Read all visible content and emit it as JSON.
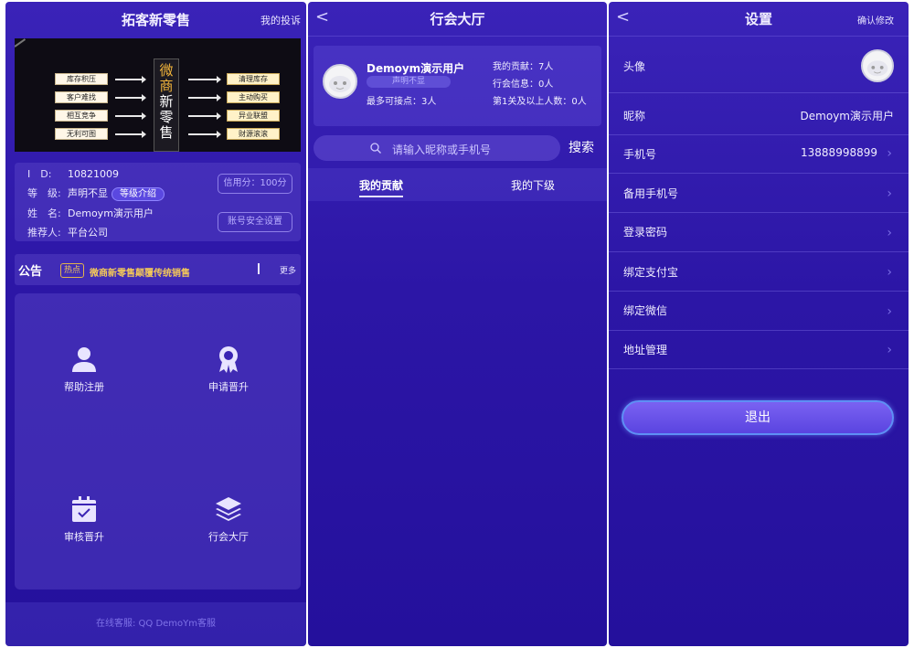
{
  "home": {
    "title": "拓客新零售",
    "complaint": "我的投诉",
    "banner": {
      "left_items": [
        "库存积压",
        "客户难找",
        "相互竞争",
        "无利可图"
      ],
      "center_chars": [
        "微",
        "商",
        "新",
        "零",
        "售"
      ],
      "right_items": [
        "清理库存",
        "主动购买",
        "异业联盟",
        "财源滚滚"
      ]
    },
    "profile": {
      "id_label": "I　D:",
      "id_value": "10821009",
      "level_label": "等　级:",
      "level_value": "声明不显",
      "level_intro": "等级介绍",
      "name_label": "姓　名:",
      "name_value": "Demoym演示用户",
      "referrer_label": "推荐人:",
      "referrer_value": "平台公司",
      "credit_button": "信用分：100分",
      "security_button": "账号安全设置"
    },
    "notice": {
      "title": "公告",
      "hot": "热点",
      "text": "微商新零售颠覆传统销售",
      "more": "更多"
    },
    "grid": [
      {
        "label": "帮助注册",
        "icon": "user-icon"
      },
      {
        "label": "申请晋升",
        "icon": "award-icon"
      },
      {
        "label": "审核晋升",
        "icon": "calendar-check-icon"
      },
      {
        "label": "行会大厅",
        "icon": "layers-icon"
      }
    ],
    "footer": "在线客服:   QQ DemoYm客服"
  },
  "hall": {
    "back": "<",
    "title": "行会大厅",
    "user_name": "Demoym演示用户",
    "user_badge": "声明不显",
    "max_contacts": "最多可接点：3人",
    "contribution": "我的贡献：7人",
    "guild_info": "行会信息：0人",
    "level1_plus": "第1关及以上人数：0人",
    "search_placeholder": "请输入昵称或手机号",
    "search_button": "搜索",
    "tabs": [
      "我的贡献",
      "我的下级"
    ]
  },
  "settings": {
    "back": "<",
    "title": "设置",
    "confirm": "确认修改",
    "rows": [
      {
        "label": "头像",
        "value": ""
      },
      {
        "label": "昵称",
        "value": "Demoym演示用户"
      },
      {
        "label": "手机号",
        "value": "13888998899"
      },
      {
        "label": "备用手机号",
        "value": ""
      },
      {
        "label": "登录密码",
        "value": ""
      },
      {
        "label": "绑定支付宝",
        "value": ""
      },
      {
        "label": "绑定微信",
        "value": ""
      },
      {
        "label": "地址管理",
        "value": ""
      }
    ],
    "logout": "退出"
  },
  "colors": {
    "background": "#2c16a6",
    "accent": "#5a44e0",
    "notice_gold": "#f2c75a"
  }
}
